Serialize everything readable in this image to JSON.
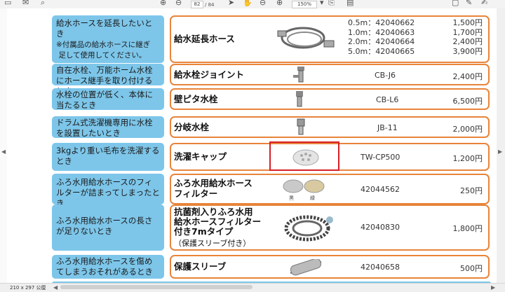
{
  "toolbar": {
    "page_current": "82",
    "page_total": "/ 84",
    "zoom": "150%"
  },
  "statusbar": {
    "page_size": "210 x 297 公厘"
  },
  "rows": [
    {
      "category": "給水ホースを延長したいとき\n※付属品の給水ホースに継ぎ足して使用してください。",
      "name": "給水延長ホース",
      "variants": [
        {
          "code": "0.5m：42040662",
          "price": "1,500円"
        },
        {
          "code": "1.0m：42040663",
          "price": "1,700円"
        },
        {
          "code": "2.0m：42040664",
          "price": "2,400円"
        },
        {
          "code": "5.0m：42040665",
          "price": "3,900円"
        }
      ],
      "icon": "hose-coil-icon"
    },
    {
      "category": "自在水栓、万能ホーム水栓にホース継手を取り付けるとき",
      "name": "給水栓ジョイント",
      "code": "CB-J6",
      "price": "2,400円",
      "icon": "faucet-joint-icon"
    },
    {
      "category": "水栓の位置が低く、本体に当たるとき",
      "name": "壁ピタ水栓",
      "code": "CB-L6",
      "price": "6,500円",
      "icon": "wall-faucet-icon"
    },
    {
      "category": "ドラム式洗濯機専用に水栓を設置したいとき",
      "name": "分岐水栓",
      "code": "JB-11",
      "price": "2,000円",
      "icon": "branch-faucet-icon"
    },
    {
      "category": "3kgより重い毛布を洗濯するとき",
      "name": "洗濯キャップ",
      "code": "TW-CP500",
      "price": "1,200円",
      "icon": "wash-cap-icon"
    },
    {
      "category": "ふろ水用給水ホースのフィルターが詰まってしまったとき",
      "name": "ふろ水用給水ホース\nフィルター",
      "code": "42044562",
      "price": "250円",
      "icon": "filter-icon",
      "filter_labels": [
        "黒",
        "緑"
      ]
    },
    {
      "category": "ふろ水用給水ホースの長さが足りないとき",
      "name": "抗菌剤入りふろ水用\n給水ホースフィルター\n付き7mタイプ",
      "note": "（保護スリーブ付き）",
      "code": "42040830",
      "price": "1,800円",
      "icon": "bath-hose-icon"
    },
    {
      "category": "ふろ水用給水ホースを傷めてしまうおそれがあるとき",
      "name": "保護スリーブ",
      "code": "42040658",
      "price": "500円",
      "icon": "sleeve-icon"
    }
  ]
}
